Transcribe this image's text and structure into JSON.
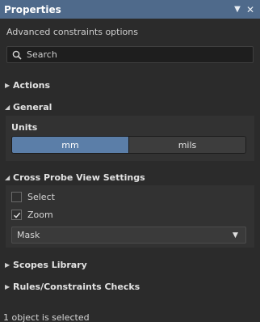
{
  "titlebar": {
    "title": "Properties",
    "menu_glyph": "▼",
    "close_glyph": "✕"
  },
  "subtitle": "Advanced constraints options",
  "search": {
    "placeholder": "Search"
  },
  "sections": {
    "actions": "Actions",
    "general": "General",
    "cross_probe": "Cross Probe View Settings",
    "scopes": "Scopes Library",
    "rules": "Rules/Constraints Checks"
  },
  "units": {
    "label": "Units",
    "options": [
      "mm",
      "mils"
    ],
    "selected": "mm"
  },
  "cross_probe": {
    "select_label": "Select",
    "select_checked": false,
    "zoom_label": "Zoom",
    "zoom_checked": true,
    "mode_value": "Mask"
  },
  "status": "1 object is selected",
  "colors": {
    "titlebar": "#4f6a8b",
    "accent": "#5b7ea8",
    "background": "#2b2b2b"
  }
}
